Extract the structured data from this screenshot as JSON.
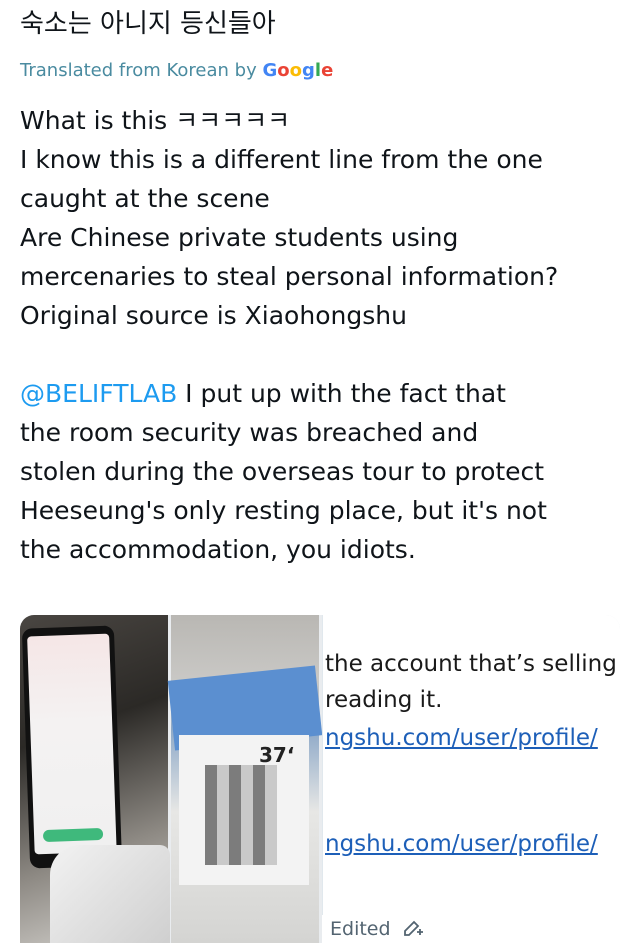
{
  "post": {
    "original_text": "숙소는 아니지 등신들아",
    "translated_prefix": "Translated from Korean by",
    "translator_logo": "Google",
    "lines": [
      "What is this ㅋㅋㅋㅋㅋ",
      "I know this is a different line from the one",
      "caught at the scene",
      "Are Chinese private students using",
      "mercenaries to steal personal information?",
      "Original source is Xiaohongshu"
    ],
    "mention": "@BELIFTLAB",
    "reply_first_line": " I put up with the fact that",
    "reply_lines": [
      "the room security was breached and",
      "stolen during the overseas tour to protect",
      "Heeseung's only resting place, but it's not",
      "the accommodation, you idiots."
    ]
  },
  "media": {
    "screenshot_lines": [
      "the account that’s selling",
      "reading it.",
      "ngshu.com/user/profile/",
      "ngshu.com/user/profile/"
    ],
    "package_number": "37‘",
    "edited_label": "Edited",
    "edited_icon": "edit-pencil-icon"
  },
  "colors": {
    "translated": "#4a8ba0",
    "mention": "#1d9bf0",
    "link": "#1d5fb8"
  }
}
